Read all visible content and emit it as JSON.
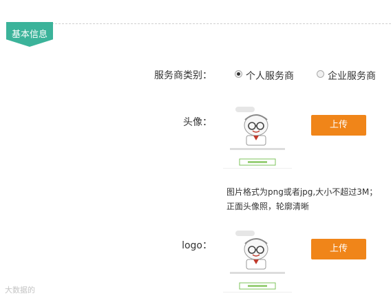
{
  "section": {
    "title": "基本信息"
  },
  "service_type": {
    "label": "服务商类别：",
    "options": [
      {
        "label": "个人服务商",
        "checked": true
      },
      {
        "label": "企业服务商",
        "checked": false
      }
    ]
  },
  "avatar": {
    "label": "头像：",
    "upload_label": "上传",
    "hint_line1": "图片格式为png或者jpg,大小不超过3M；",
    "hint_line2": "正面头像照，轮廓清晰"
  },
  "logo": {
    "label": "logo：",
    "upload_label": "上传"
  },
  "watermark": {
    "text": "大数据的"
  },
  "colors": {
    "accent": "#3bb39a",
    "button": "#f08519"
  },
  "icons": [
    "cartoon-avatar-placeholder-icon",
    "radio-icon"
  ]
}
